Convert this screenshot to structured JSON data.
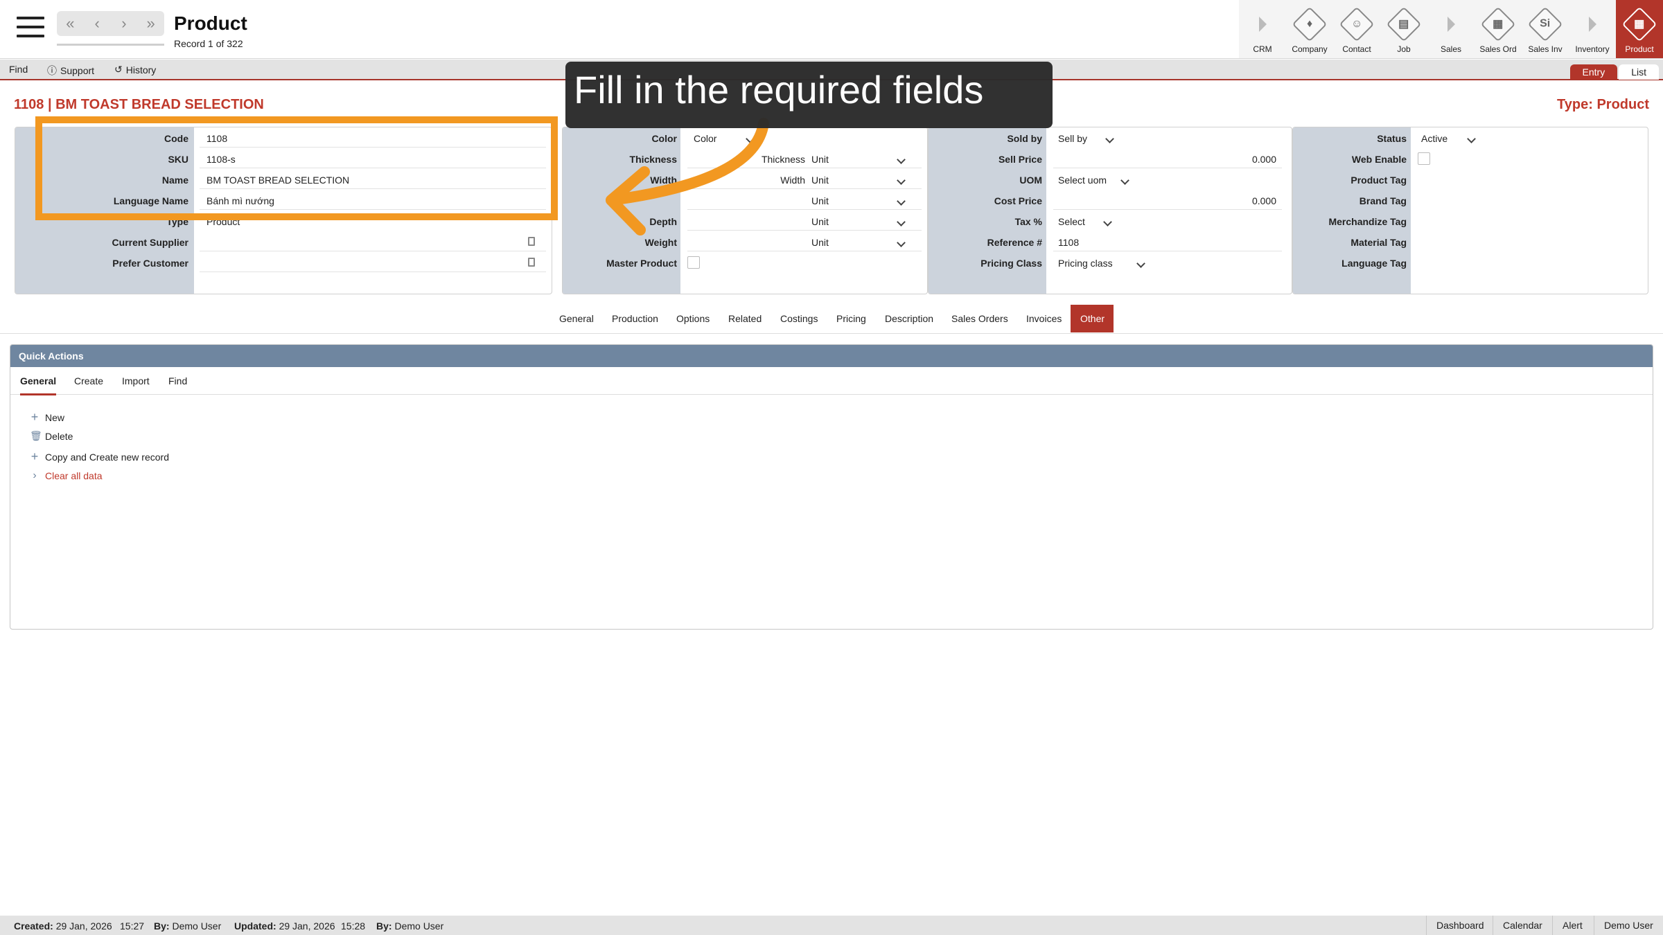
{
  "header": {
    "title": "Product",
    "record": "Record 1 of 322",
    "nav": [
      "«",
      "‹",
      "›",
      "»"
    ]
  },
  "modules": [
    {
      "label": "CRM",
      "icon": "play-icon",
      "kind": "arrow"
    },
    {
      "label": "Company",
      "icon": "company-icon",
      "kind": "diamond",
      "glyph": "♦"
    },
    {
      "label": "Contact",
      "icon": "contact-icon",
      "kind": "diamond",
      "glyph": "☺"
    },
    {
      "label": "Job",
      "icon": "job-icon",
      "kind": "diamond",
      "glyph": "▤"
    },
    {
      "label": "Sales",
      "icon": "play-icon",
      "kind": "arrow"
    },
    {
      "label": "Sales Ord",
      "icon": "sales-order-icon",
      "kind": "diamond",
      "glyph": "▦"
    },
    {
      "label": "Sales Inv",
      "icon": "sales-invoice-icon",
      "kind": "diamond",
      "glyph": "Si"
    },
    {
      "label": "Inventory",
      "icon": "play-icon",
      "kind": "arrow"
    },
    {
      "label": "Product",
      "icon": "product-icon",
      "kind": "diamond",
      "glyph": "▦",
      "active": true
    }
  ],
  "toolbar": {
    "find": "Find",
    "support": "Support",
    "history": "History",
    "entry": "Entry",
    "list": "List"
  },
  "record": {
    "heading": "1108 | BM TOAST BREAD SELECTION",
    "type": "Type: Product"
  },
  "panel1": {
    "code_label": "Code",
    "code": "1108",
    "sku_label": "SKU",
    "sku": "1108-s",
    "name_label": "Name",
    "name": "BM TOAST BREAD SELECTION",
    "lang_label": "Language Name",
    "lang": "Bánh mì nướng",
    "type_label": "Type",
    "type": "Product",
    "supplier_label": "Current Supplier",
    "customer_label": "Prefer Customer"
  },
  "panel2": {
    "color_label": "Color",
    "color": "Color",
    "thickness_label": "Thickness",
    "thickness_ph": "Thickness",
    "width_label": "Width",
    "width_ph": "Width",
    "depth_label": "Depth",
    "weight_label": "Weight",
    "master_label": "Master Product",
    "unit": "Unit"
  },
  "panel3": {
    "soldby_label": "Sold by",
    "soldby": "Sell by",
    "sellprice_label": "Sell Price",
    "sellprice": "0.000",
    "uom_label": "UOM",
    "uom": "Select uom",
    "costprice_label": "Cost Price",
    "costprice": "0.000",
    "tax_label": "Tax %",
    "tax": "Select",
    "ref_label": "Reference #",
    "ref": "1108",
    "pricing_label": "Pricing Class",
    "pricing": "Pricing class"
  },
  "panel4": {
    "status_label": "Status",
    "status": "Active",
    "web_label": "Web Enable",
    "ptag_label": "Product Tag",
    "btag_label": "Brand Tag",
    "mtag_label": "Merchandize Tag",
    "mattag_label": "Material Tag",
    "ltag_label": "Language Tag"
  },
  "tabs": [
    "General",
    "Production",
    "Options",
    "Related",
    "Costings",
    "Pricing",
    "Description",
    "Sales Orders",
    "Invoices",
    "Other"
  ],
  "quick_actions": {
    "title": "Quick Actions",
    "tabs": [
      "General",
      "Create",
      "Import",
      "Find"
    ],
    "actions": [
      "New",
      "Delete",
      "Copy and Create new record",
      "Clear all data"
    ]
  },
  "footer": {
    "created_label": "Created:",
    "created": "29 Jan, 2026",
    "created_time": "15:27",
    "by_label": "By:",
    "created_by": "Demo User",
    "updated_label": "Updated:",
    "updated": "29 Jan, 2026",
    "updated_time": "15:28",
    "updated_by": "Demo User",
    "links": [
      "Dashboard",
      "Calendar",
      "Alert",
      "Demo User"
    ]
  },
  "annotation": {
    "text": "Fill in the required fields",
    "color": "#f29821"
  },
  "colors": {
    "accent": "#b2352a",
    "heading": "#c0392b",
    "label_bg": "#ccd3dc",
    "qa_header": "#6f86a0"
  }
}
